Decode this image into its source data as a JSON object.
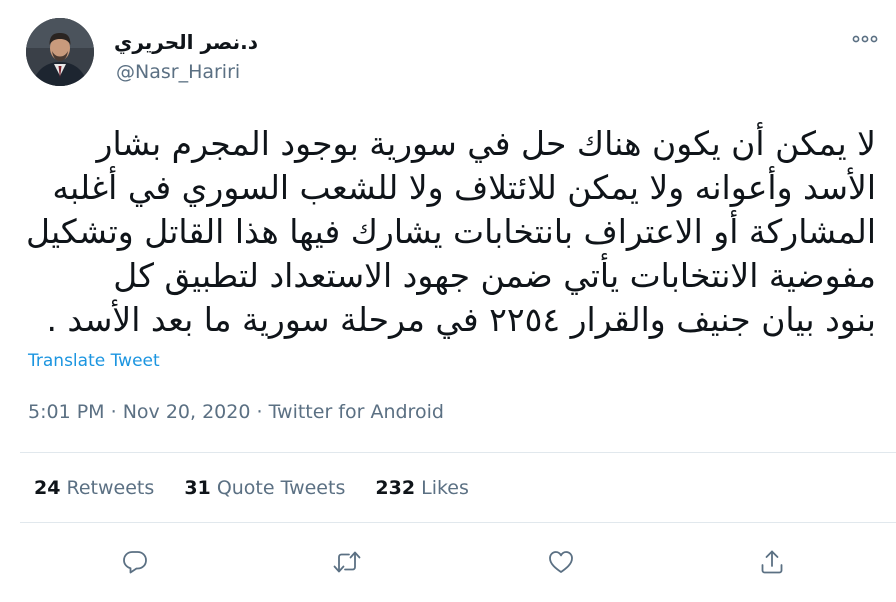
{
  "author": {
    "display_name": "د.نصر الحريري",
    "handle": "@Nasr_Hariri"
  },
  "tweet": {
    "lines": [
      "لا يمكن أن يكون هناك حل في سورية بوجود المجرم بشار",
      "الأسد وأعوانه ولا يمكن للائتلاف ولا للشعب السوري في أغلبه",
      "المشاركة أو الاعتراف بانتخابات يشارك فيها هذا القاتل وتشكيل",
      "مفوضية الانتخابات يأتي ضمن جهود الاستعداد لتطبيق كل",
      "بنود بيان جنيف والقرار ٢٢٥٤ في مرحلة سورية ما بعد الأسد ."
    ],
    "translate_label": "Translate Tweet",
    "time": "5:01 PM",
    "separator": "·",
    "date": "Nov 20, 2020",
    "source": "Twitter for Android"
  },
  "stats": {
    "retweets_count": "24",
    "retweets_label": "Retweets",
    "quotes_count": "31",
    "quotes_label": "Quote Tweets",
    "likes_count": "232",
    "likes_label": "Likes"
  },
  "icons": {
    "more": "more-dots-icon",
    "reply": "reply-bubble-icon",
    "retweet": "retweet-arrows-icon",
    "like": "heart-icon",
    "share": "share-upload-icon"
  },
  "colors": {
    "link": "#1b95e0",
    "muted": "#5b7083",
    "text": "#0f1419",
    "divider": "#e1e8ed"
  }
}
